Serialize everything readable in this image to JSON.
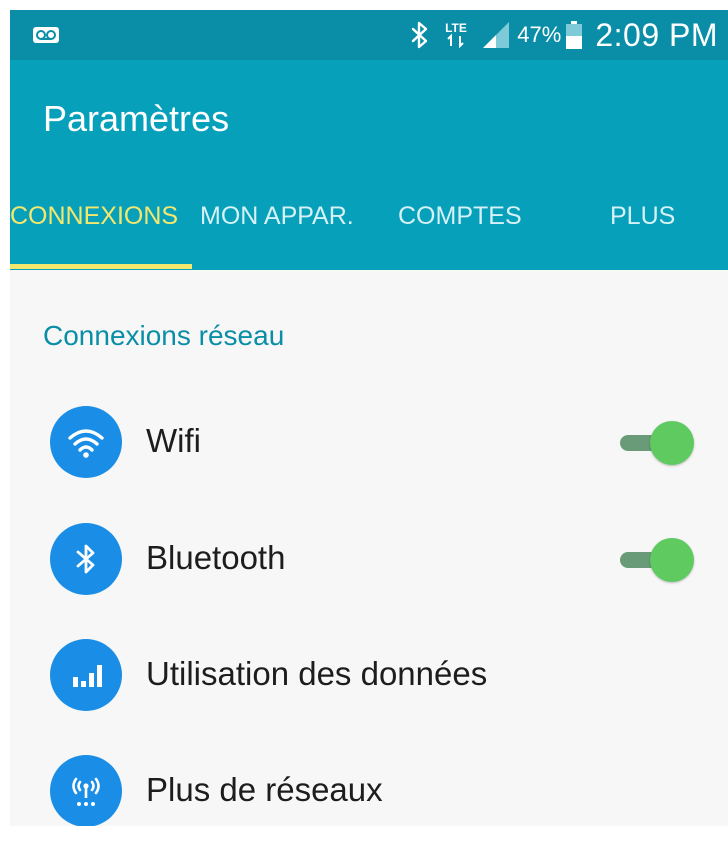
{
  "status_bar": {
    "lte_label": "LTE",
    "battery_percent": "47%",
    "time": "2:09 PM",
    "icons": [
      "voicemail-icon",
      "bluetooth-icon",
      "lte-icon",
      "signal-icon",
      "battery-icon"
    ]
  },
  "app_bar": {
    "title": "Paramètres"
  },
  "tabs": [
    {
      "label": "CONNEXIONS",
      "active": true
    },
    {
      "label": "MON APPAR.",
      "active": false
    },
    {
      "label": "COMPTES",
      "active": false
    },
    {
      "label": "PLUS",
      "active": false
    }
  ],
  "section": {
    "header": "Connexions réseau"
  },
  "settings": [
    {
      "label": "Wifi",
      "icon": "wifi-icon",
      "toggle": true,
      "enabled": true
    },
    {
      "label": "Bluetooth",
      "icon": "bluetooth-icon",
      "toggle": true,
      "enabled": true
    },
    {
      "label": "Utilisation des données",
      "icon": "data-usage-icon",
      "toggle": false
    },
    {
      "label": "Plus de réseaux",
      "icon": "more-networks-icon",
      "toggle": false
    }
  ],
  "colors": {
    "status_bar": "#0a8ea7",
    "app_bar": "#06a0bb",
    "active_tab": "#f4e76e",
    "inactive_tab": "#d6f1f6",
    "section_header": "#0a8ea7",
    "icon_circle": "#1a8ee6",
    "toggle_thumb": "#5fca5f",
    "toggle_track": "#6a9b78",
    "background": "#f7f7f7"
  }
}
